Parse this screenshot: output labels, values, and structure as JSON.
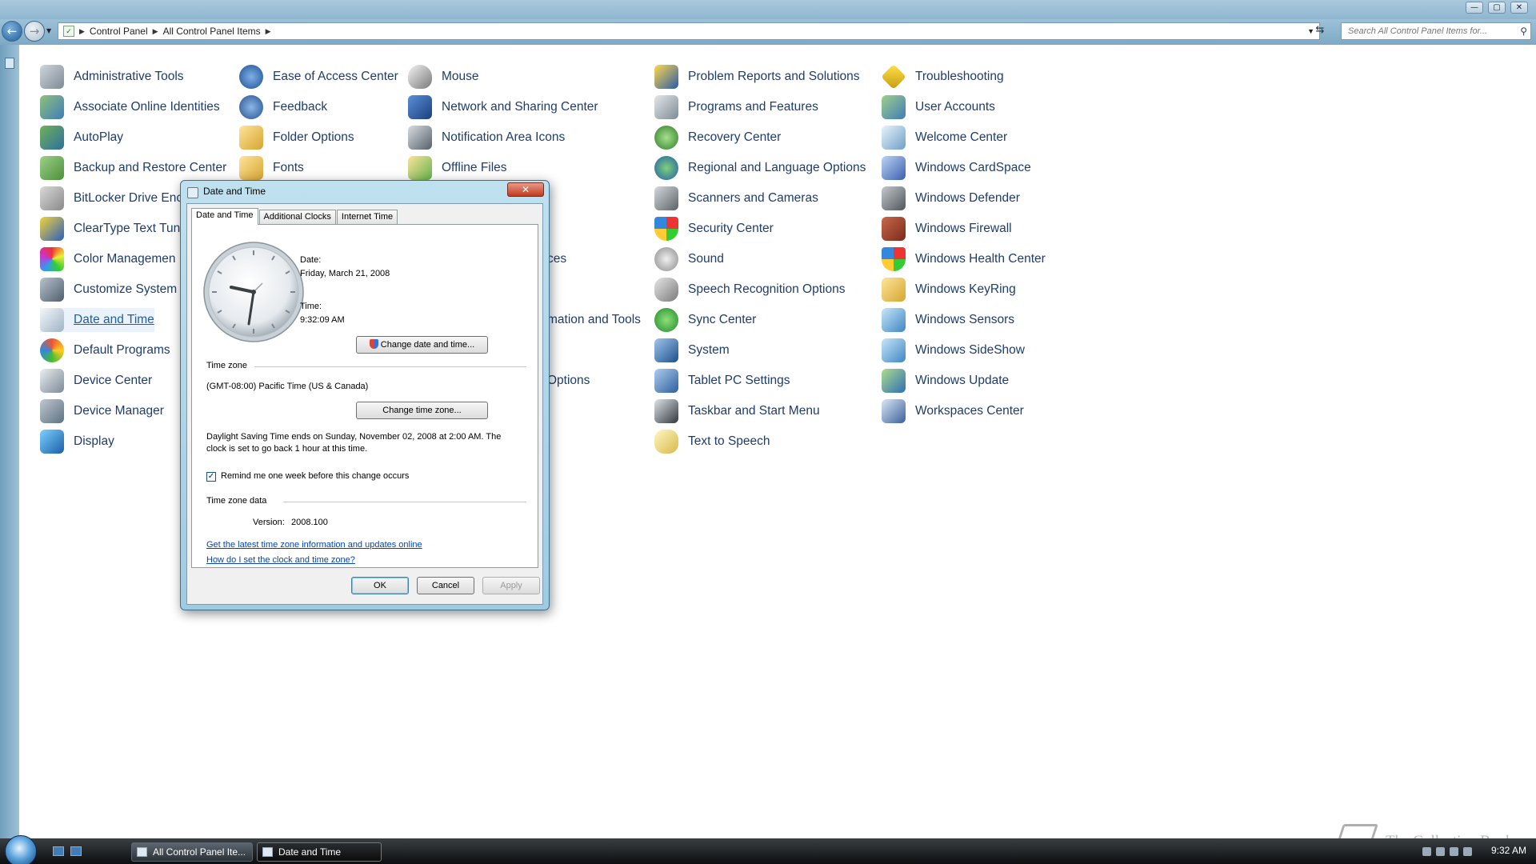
{
  "window": {
    "controls": [
      "—",
      "▢",
      "✕"
    ]
  },
  "address": {
    "crumbs": [
      "Control Panel",
      "All Control Panel Items"
    ],
    "search_placeholder": "Search All Control Panel Items for..."
  },
  "control_panel": {
    "columns": [
      [
        "Administrative Tools",
        "Associate Online Identities",
        "AutoPlay",
        "Backup and Restore Center",
        "BitLocker Drive Enc",
        "ClearType Text Tun",
        "Color Managemen",
        "Customize System",
        "Date and Time",
        "Default Programs",
        "Device Center",
        "Device Manager",
        "Display"
      ],
      [
        "Ease of Access Center",
        "Feedback",
        "Folder Options",
        "Fonts"
      ],
      [
        "Mouse",
        "Network and Sharing Center",
        "Notification Area Icons",
        "Offline Files"
      ],
      [
        "Problem Reports and Solutions",
        "Programs and Features",
        "Recovery Center",
        "Regional and Language Options",
        "Scanners and Cameras",
        "Security Center",
        "Sound",
        "Speech Recognition Options",
        "Sync Center",
        "System",
        "Tablet PC Settings",
        "Taskbar and Start Menu",
        "Text to Speech"
      ],
      [
        "Troubleshooting",
        "User Accounts",
        "Welcome Center",
        "Windows CardSpace",
        "Windows Defender",
        "Windows Firewall",
        "Windows Health Center",
        "Windows KeyRing",
        "Windows Sensors",
        "Windows SideShow",
        "Windows Update",
        "Workspaces Center"
      ]
    ],
    "partials": [
      "ces",
      "mation and Tools",
      "Options"
    ]
  },
  "dialog": {
    "title": "Date and Time",
    "tabs": [
      "Date and Time",
      "Additional Clocks",
      "Internet Time"
    ],
    "date_label": "Date:",
    "date_value": "Friday, March 21, 2008",
    "time_label": "Time:",
    "time_value": "9:32:09 AM",
    "change_datetime_button": "Change date and time...",
    "timezone_header": "Time zone",
    "timezone_value": "(GMT-08:00) Pacific Time (US & Canada)",
    "change_timezone_button": "Change time zone...",
    "dst_line1": "Daylight Saving Time ends on Sunday, November 02, 2008 at 2:00 AM. The",
    "dst_line2": "clock is set to go back 1 hour at this time.",
    "remind_label": "Remind me one week before this change occurs",
    "remind_checked": true,
    "tzdata_header": "Time zone data",
    "version_label": "Version:",
    "version_value": "2008.100",
    "link1": "Get the latest time zone information and updates online",
    "link2": "How do I set the clock and time zone?",
    "ok": "OK",
    "cancel": "Cancel",
    "apply": "Apply"
  },
  "taskbar": {
    "buttons": [
      "All Control Panel Ite...",
      "Date and Time"
    ],
    "clock": "9:32 AM"
  },
  "watermark": "The Collection Book",
  "colors": {
    "link": "#1e3d6b",
    "accent": "#7ea9c4"
  }
}
